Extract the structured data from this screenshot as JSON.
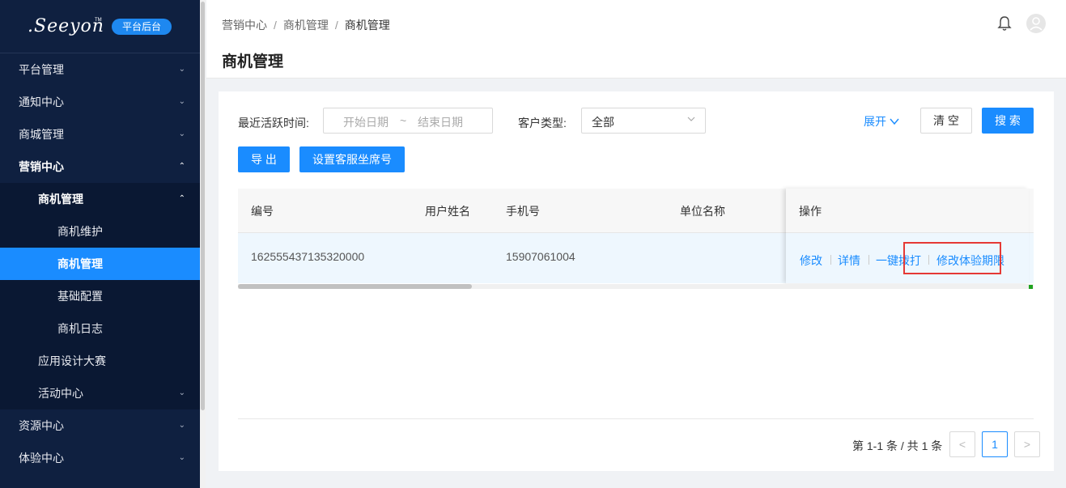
{
  "sidebar": {
    "logo_text": ".Seeyon",
    "logo_tm": "TM",
    "badge": "平台后台",
    "items": [
      {
        "label": "平台管理"
      },
      {
        "label": "通知中心"
      },
      {
        "label": "商城管理"
      },
      {
        "label": "营销中心"
      },
      {
        "label": "商机管理"
      },
      {
        "label": "商机维护"
      },
      {
        "label": "商机管理"
      },
      {
        "label": "基础配置"
      },
      {
        "label": "商机日志"
      },
      {
        "label": "应用设计大赛"
      },
      {
        "label": "活动中心"
      },
      {
        "label": "资源中心"
      },
      {
        "label": "体验中心"
      }
    ]
  },
  "header": {
    "breadcrumb": [
      "营销中心",
      "商机管理",
      "商机管理"
    ],
    "title": "商机管理"
  },
  "filters": {
    "active_time_label": "最近活跃时间:",
    "start_placeholder": "开始日期",
    "range_sep": "~",
    "end_placeholder": "结束日期",
    "customer_type_label": "客户类型:",
    "customer_type_value": "全部",
    "expand_label": "展开",
    "clear_label": "清 空",
    "search_label": "搜 索"
  },
  "toolbar": {
    "export_label": "导 出",
    "set_seat_label": "设置客服坐席号"
  },
  "table": {
    "columns": [
      "编号",
      "用户姓名",
      "手机号",
      "单位名称",
      "操作"
    ],
    "rows": [
      {
        "id": "162555437135320000",
        "name": "",
        "phone": "15907061004",
        "company": ""
      }
    ],
    "actions": [
      "修改",
      "详情",
      "一键拨打",
      "修改体验期限"
    ]
  },
  "pagination": {
    "info": "第 1-1 条 / 共 1 条",
    "prev": "<",
    "current": "1",
    "next": ">"
  },
  "colors": {
    "primary": "#1a8cff",
    "sidebar_bg": "#0f2040",
    "highlight": "#e53935"
  }
}
